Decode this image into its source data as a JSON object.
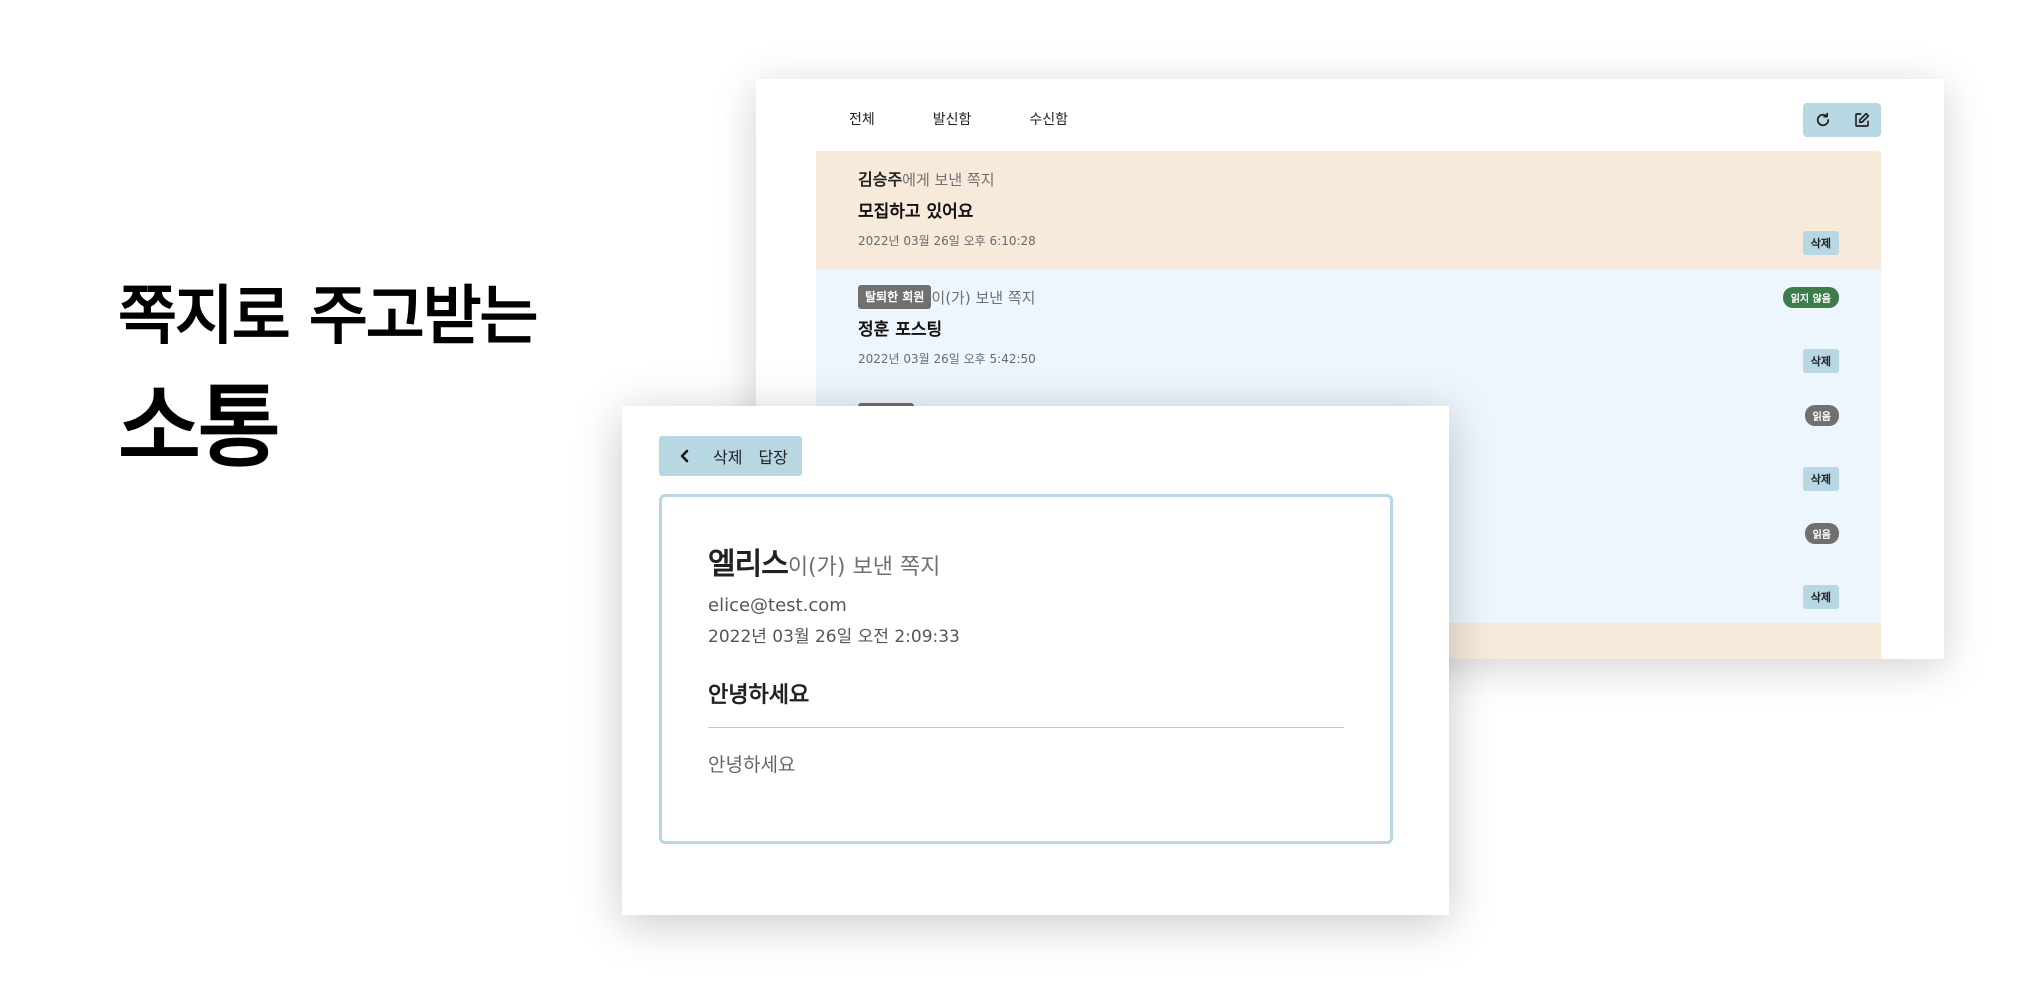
{
  "hero": {
    "line1": "쪽지로 주고받는",
    "line2": "소통"
  },
  "list_window": {
    "tabs": [
      {
        "label": "전체"
      },
      {
        "label": "발신함"
      },
      {
        "label": "수신함"
      }
    ],
    "toolbar": {
      "refresh_icon": "refresh-icon",
      "compose_icon": "compose-icon"
    },
    "messages": [
      {
        "kind": "sent",
        "sender": "김승주",
        "suffix": "에게 보낸 쪽지",
        "subject": "모집하고 있어요",
        "date": "2022년 03월 26일 오후 6:10:28",
        "delete_label": "삭제"
      },
      {
        "kind": "received",
        "sender_badge": "탈퇴한 회원",
        "suffix": "이(가) 보낸 쪽지",
        "subject": "정훈 포스팅",
        "date": "2022년 03월 26일 오후 5:42:50",
        "status": "읽지 않음",
        "delete_label": "삭제"
      },
      {
        "kind": "received",
        "status": "읽음",
        "delete_label": "삭제"
      },
      {
        "kind": "received",
        "status": "읽음",
        "delete_label": "삭제"
      }
    ],
    "colors": {
      "sent_row": "#f7eadb",
      "received_row": "#eef6fd",
      "accent": "#b7d7e2",
      "unread_badge": "#3d7d4c",
      "read_badge": "#707070"
    }
  },
  "detail_window": {
    "toolbar": {
      "back_icon": "chevron-left-icon",
      "delete_label": "삭제",
      "reply_label": "답장"
    },
    "sender": "엘리스",
    "suffix": "이(가) 보낸 쪽지",
    "email": "elice@test.com",
    "date": "2022년 03월 26일 오전 2:09:33",
    "subject": "안녕하세요",
    "body": "안녕하세요"
  }
}
